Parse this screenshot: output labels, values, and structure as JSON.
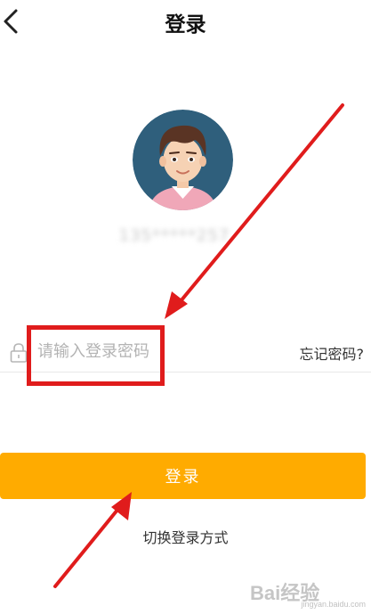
{
  "header": {
    "title": "登录",
    "back_icon": "chevron-left-icon"
  },
  "account": {
    "masked_number": "135*****257"
  },
  "password": {
    "placeholder": "请输入登录密码",
    "lock_icon": "lock-icon",
    "forgot_label": "忘记密码?"
  },
  "login_button": {
    "label": "登录",
    "color": "#ffab00"
  },
  "switch_login": {
    "label": "切换登录方式"
  },
  "annotations": {
    "color": "#e01c1c"
  },
  "watermark": {
    "brand": "Bai经验",
    "url": "jingyan.baidu.com"
  }
}
